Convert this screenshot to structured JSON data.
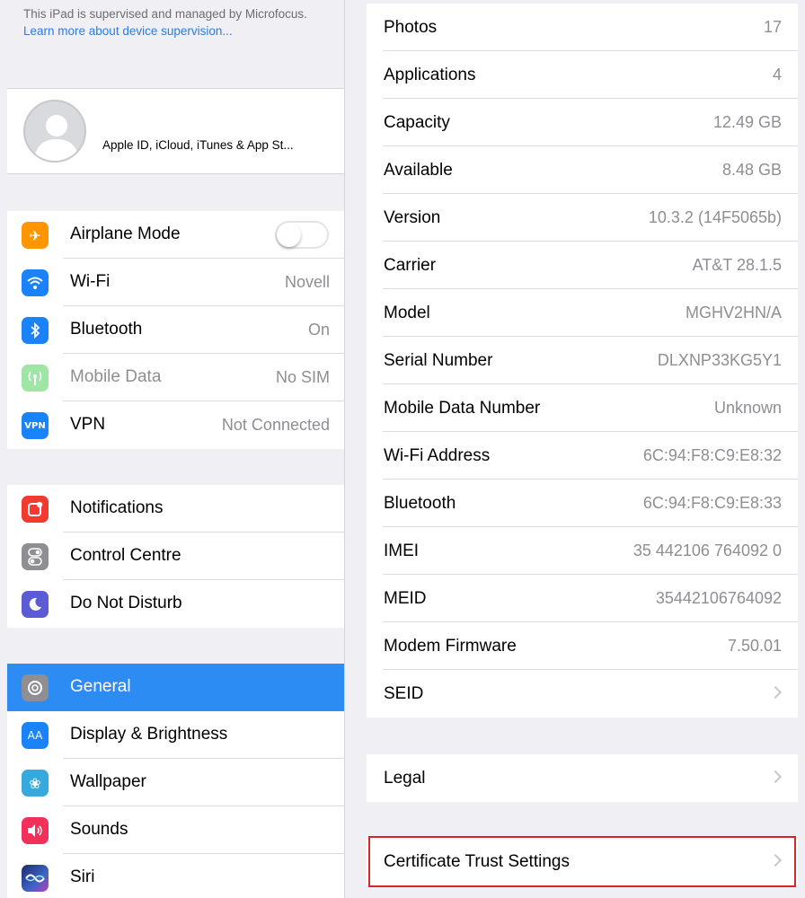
{
  "sidebar": {
    "supervision_text": "This iPad is supervised and managed by Microfocus.",
    "supervision_link": "Learn more about device supervision...",
    "profile_label": "Apple ID, iCloud, iTunes & App St...",
    "items": [
      {
        "label": "Airplane Mode",
        "value": "",
        "icon": "airplane-icon",
        "color": "#ff9500",
        "glyph": "✈"
      },
      {
        "label": "Wi-Fi",
        "value": "Novell",
        "icon": "wifi-icon",
        "color": "#1a82fb",
        "glyph": "≋"
      },
      {
        "label": "Bluetooth",
        "value": "On",
        "icon": "bluetooth-icon",
        "color": "#1a82fb",
        "glyph": "ᛒ"
      },
      {
        "label": "Mobile Data",
        "value": "No SIM",
        "icon": "antenna-icon",
        "color": "#9fe5a6",
        "glyph": "((·))"
      },
      {
        "label": "VPN",
        "value": "Not Connected",
        "icon": "vpn-icon",
        "color": "#1a82fb",
        "glyph": "VPN"
      },
      {
        "label": "Notifications",
        "value": "",
        "icon": "notifications-icon",
        "color": "#f23b30",
        "glyph": "▢"
      },
      {
        "label": "Control Centre",
        "value": "",
        "icon": "control-centre-icon",
        "color": "#8e8e93",
        "glyph": "⊜"
      },
      {
        "label": "Do Not Disturb",
        "value": "",
        "icon": "moon-icon",
        "color": "#5b5bd6",
        "glyph": "☾"
      },
      {
        "label": "General",
        "value": "",
        "icon": "gear-icon",
        "color": "#8e8e93",
        "glyph": "⚙"
      },
      {
        "label": "Display & Brightness",
        "value": "",
        "icon": "display-icon",
        "color": "#1a82fb",
        "glyph": "AA"
      },
      {
        "label": "Wallpaper",
        "value": "",
        "icon": "wallpaper-icon",
        "color": "#36aadc",
        "glyph": "❀"
      },
      {
        "label": "Sounds",
        "value": "",
        "icon": "speaker-icon",
        "color": "#f2305a",
        "glyph": "◀)"
      },
      {
        "label": "Siri",
        "value": "",
        "icon": "siri-icon",
        "color": "#26337a",
        "glyph": "≈"
      }
    ]
  },
  "about": {
    "rows": [
      {
        "label": "Photos",
        "value": "17"
      },
      {
        "label": "Applications",
        "value": "4"
      },
      {
        "label": "Capacity",
        "value": "12.49 GB"
      },
      {
        "label": "Available",
        "value": "8.48 GB"
      },
      {
        "label": "Version",
        "value": "10.3.2 (14F5065b)"
      },
      {
        "label": "Carrier",
        "value": "AT&T 28.1.5"
      },
      {
        "label": "Model",
        "value": "MGHV2HN/A"
      },
      {
        "label": "Serial Number",
        "value": "DLXNP33KG5Y1"
      },
      {
        "label": "Mobile Data Number",
        "value": "Unknown"
      },
      {
        "label": "Wi-Fi Address",
        "value": "6C:94:F8:C9:E8:32"
      },
      {
        "label": "Bluetooth",
        "value": "6C:94:F8:C9:E8:33"
      },
      {
        "label": "IMEI",
        "value": "35 442106 764092 0"
      },
      {
        "label": "MEID",
        "value": "35442106764092"
      },
      {
        "label": "Modem Firmware",
        "value": "7.50.01"
      },
      {
        "label": "SEID",
        "value": ""
      }
    ],
    "legal_label": "Legal",
    "cert_label": "Certificate Trust Settings"
  },
  "colors": {
    "selected": "#2c8cf4",
    "highlight": "#d3262e"
  }
}
